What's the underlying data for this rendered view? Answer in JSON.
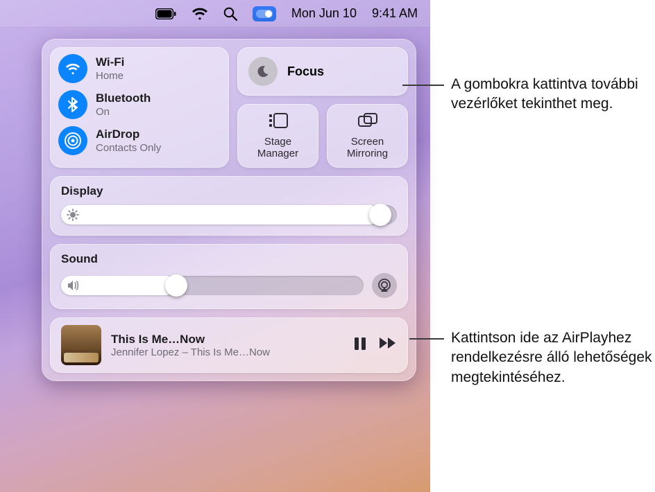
{
  "menubar": {
    "date": "Mon Jun 10",
    "time": "9:41 AM"
  },
  "connectivity": {
    "wifi": {
      "title": "Wi-Fi",
      "subtitle": "Home"
    },
    "bluetooth": {
      "title": "Bluetooth",
      "subtitle": "On"
    },
    "airdrop": {
      "title": "AirDrop",
      "subtitle": "Contacts Only"
    }
  },
  "focus": {
    "title": "Focus"
  },
  "stage": {
    "label": "Stage Manager"
  },
  "mirror": {
    "label": "Screen Mirroring"
  },
  "display": {
    "label": "Display",
    "percent": 95
  },
  "sound": {
    "label": "Sound",
    "percent": 38
  },
  "nowplaying": {
    "title": "This Is Me…Now",
    "subtitle": "Jennifer Lopez – This Is Me…Now"
  },
  "callout1": "A gombokra kattintva további vezérlőket tekinthet meg.",
  "callout2": "Kattintson ide az AirPlayhez rendelkezésre álló lehetőségek megtekintéséhez."
}
